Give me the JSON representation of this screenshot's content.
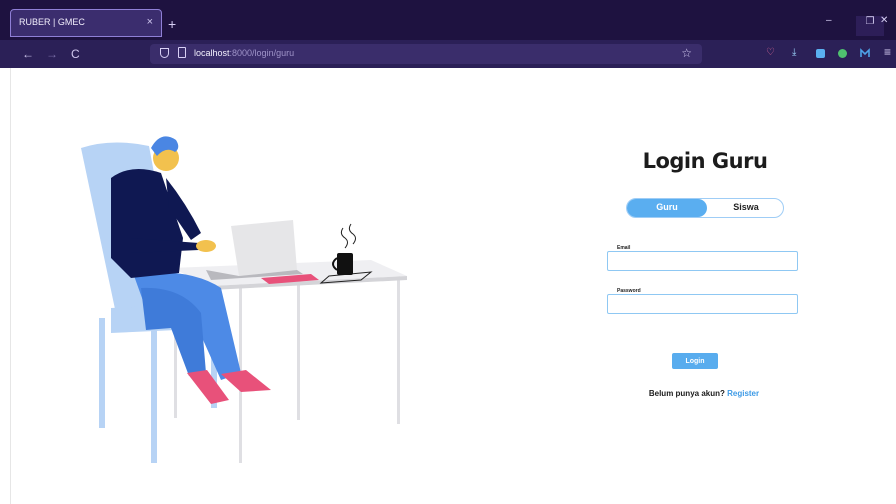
{
  "browser": {
    "tab_title": "RUBER | GMEC",
    "close_glyph": "×",
    "new_tab_glyph": "+",
    "minimize_glyph": "–",
    "maximize_glyph": "❐",
    "close_window_glyph": "✕",
    "back_glyph": "←",
    "forward_glyph": "→",
    "reload_glyph": "C",
    "url_host": "localhost",
    "url_rest": ":8000/login/guru",
    "bookmark_glyph": "☆",
    "pocket_glyph": "♡",
    "download_glyph": "⤓",
    "menu_glyph": "≡"
  },
  "login": {
    "title": "Login Guru",
    "tabs": [
      {
        "label": "Guru",
        "active": true
      },
      {
        "label": "Siswa",
        "active": false
      }
    ],
    "email_label": "Email",
    "email_value": "",
    "password_label": "Password",
    "password_value": "",
    "submit_label": "Login",
    "register_prompt": "Belum punya akun?",
    "register_link": "Register"
  },
  "colors": {
    "accent": "#58acee",
    "tab_bar": "#1e1240",
    "nav_bar": "#2b2057"
  }
}
